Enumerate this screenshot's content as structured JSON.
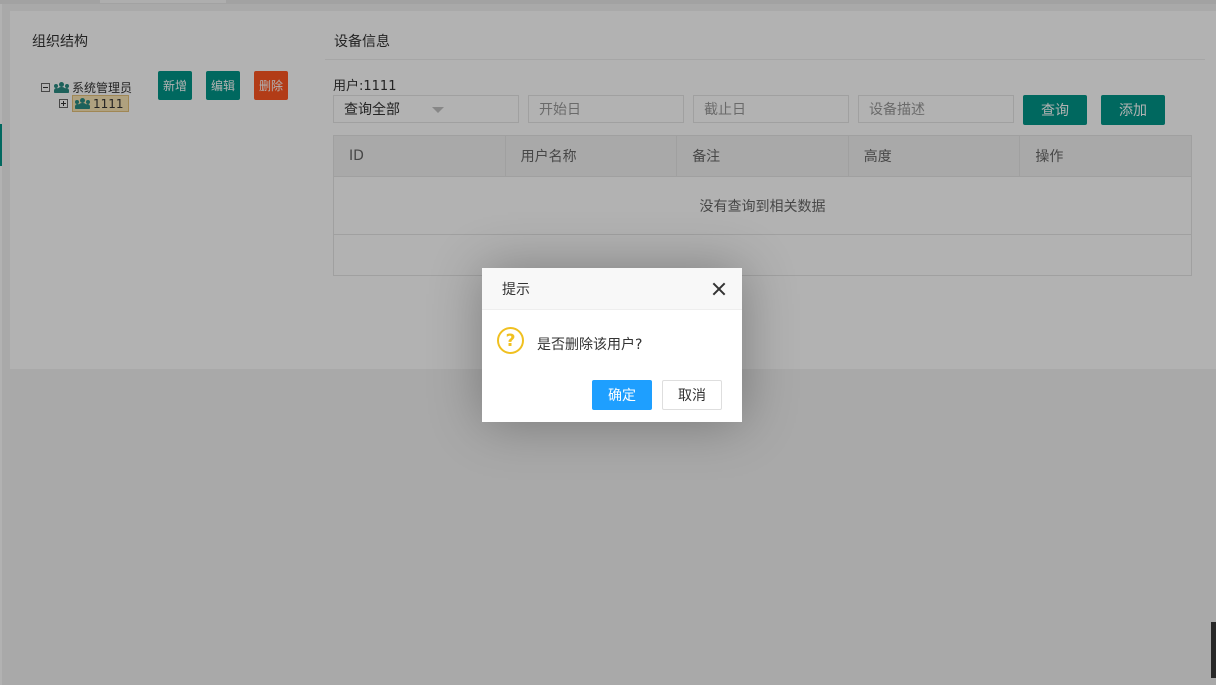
{
  "left_panel": {
    "title": "组织结构",
    "tree": [
      {
        "label": "系统管理员",
        "icon": "people-icon",
        "expanded": true
      },
      {
        "label": "1111",
        "icon": "people-icon",
        "expanded": false,
        "selected": true
      }
    ],
    "buttons": {
      "add": "新增",
      "edit": "编辑",
      "delete": "删除"
    }
  },
  "right_panel": {
    "title": "设备信息",
    "user_label": "用户:1111",
    "filters": {
      "select_value": "查询全部",
      "start_placeholder": "开始日",
      "end_placeholder": "截止日",
      "desc_placeholder": "设备描述"
    },
    "buttons": {
      "query": "查询",
      "add": "添加"
    },
    "table": {
      "columns": [
        "ID",
        "用户名称",
        "备注",
        "高度",
        "操作"
      ],
      "empty_text": "没有查询到相关数据"
    }
  },
  "dialog": {
    "title": "提示",
    "message": "是否删除该用户?",
    "icon": "question-icon",
    "icon_glyph": "?",
    "ok": "确定",
    "cancel": "取消"
  },
  "colors": {
    "accent": "#009688",
    "danger": "#ff5722",
    "primary": "#1e9fff",
    "warning_icon": "#f0c020"
  }
}
